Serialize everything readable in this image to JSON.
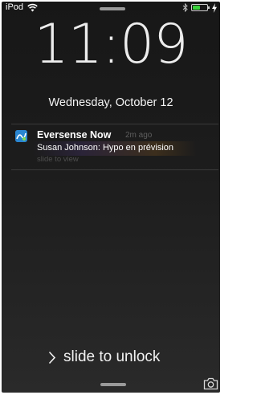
{
  "status_bar": {
    "carrier": "iPod",
    "icons": [
      "wifi-icon",
      "bluetooth-icon",
      "battery-icon",
      "charging-icon"
    ],
    "battery_level": 0.55,
    "battery_color": "#39d23a"
  },
  "lock_screen": {
    "time": "11:09",
    "date": "Wednesday, October 12"
  },
  "notification": {
    "app_icon": "eversense-app-icon",
    "app_name": "Eversense Now",
    "time_ago": "2m ago",
    "message": "Susan Johnson:  Hypo en prévision",
    "action_hint": "slide to view"
  },
  "unlock": {
    "icon": "chevron-right-icon",
    "label": "slide to unlock"
  },
  "camera": {
    "icon": "camera-icon"
  }
}
